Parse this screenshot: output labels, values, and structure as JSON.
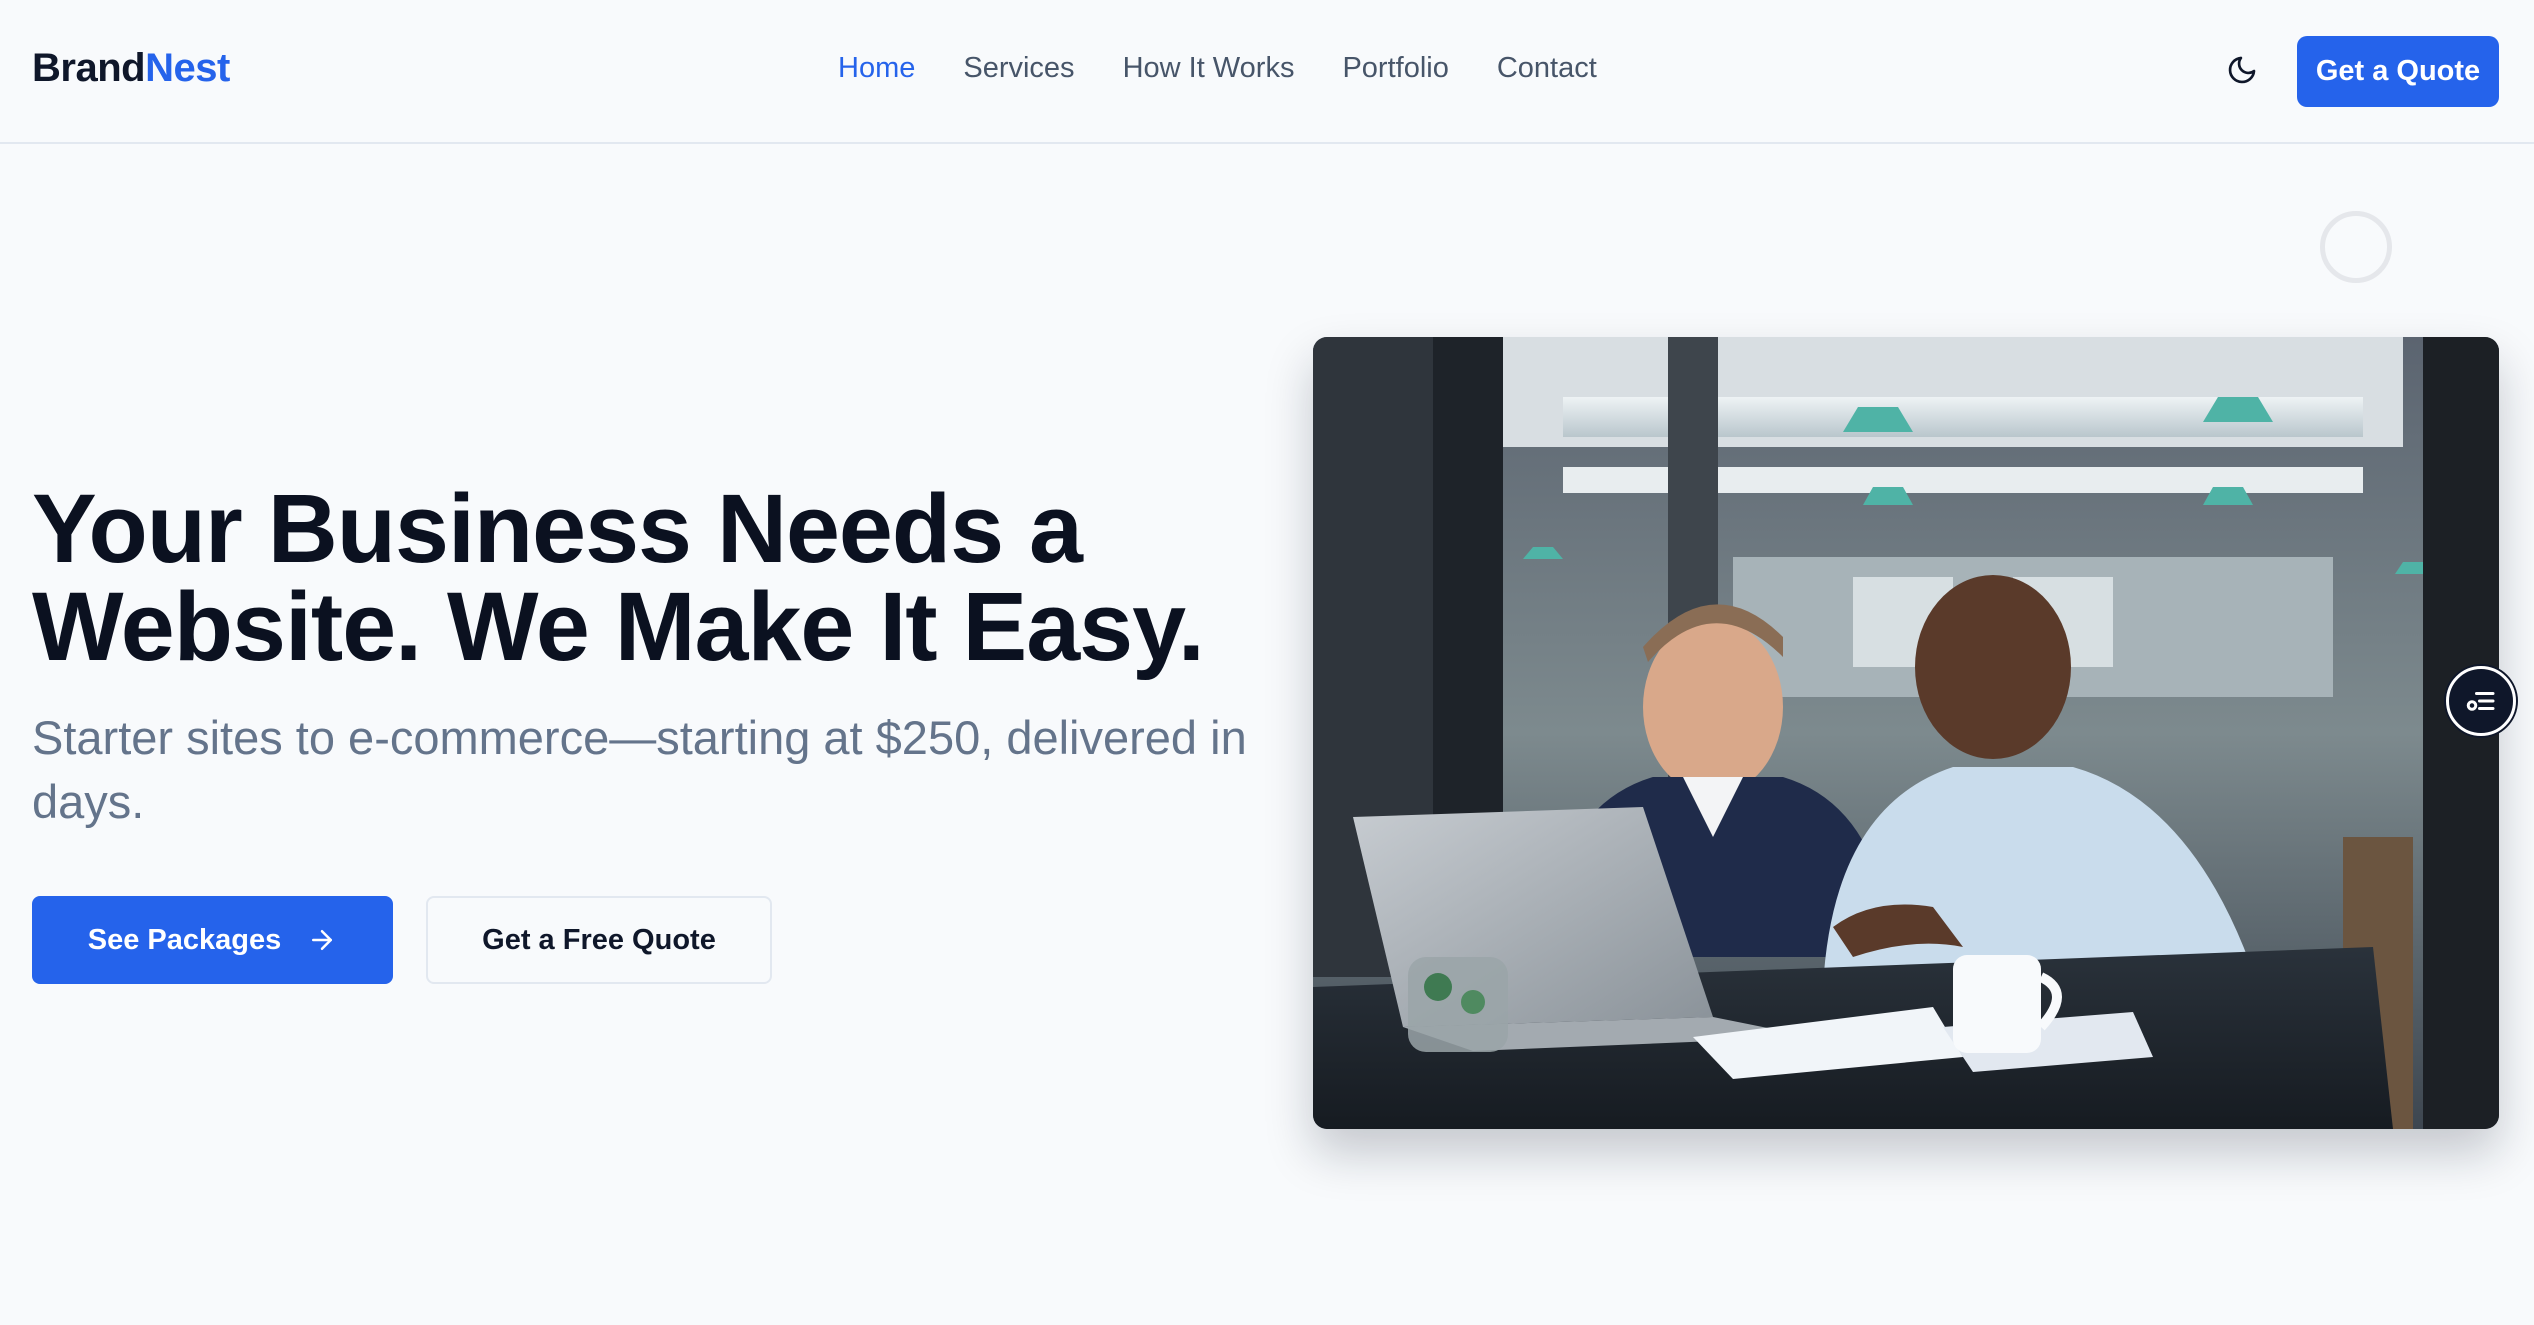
{
  "brand": {
    "name_part1": "Brand",
    "name_part2": "Nest"
  },
  "nav": {
    "items": [
      {
        "label": "Home",
        "active": true
      },
      {
        "label": "Services",
        "active": false
      },
      {
        "label": "How It Works",
        "active": false
      },
      {
        "label": "Portfolio",
        "active": false
      },
      {
        "label": "Contact",
        "active": false
      }
    ],
    "theme_toggle_icon": "moon-icon",
    "cta_label": "Get a Quote"
  },
  "hero": {
    "title_line1": "Your Business Needs a",
    "title_line2": "Website. We Make It Easy.",
    "subtitle": "Starter sites to e-commerce—starting at $250, delivered in days.",
    "primary_button": {
      "label": "See Packages",
      "icon": "arrow-right-icon"
    },
    "secondary_button": {
      "label": "Get a Free Quote"
    },
    "image_icon": "photo-two-men-laptop-office"
  },
  "floating_button": {
    "icon": "filter-list-icon"
  },
  "colors": {
    "accent": "#2563eb",
    "background": "#f8fafc",
    "heading": "#0b1120",
    "muted_text": "#64748b",
    "nav_text": "#475569"
  }
}
